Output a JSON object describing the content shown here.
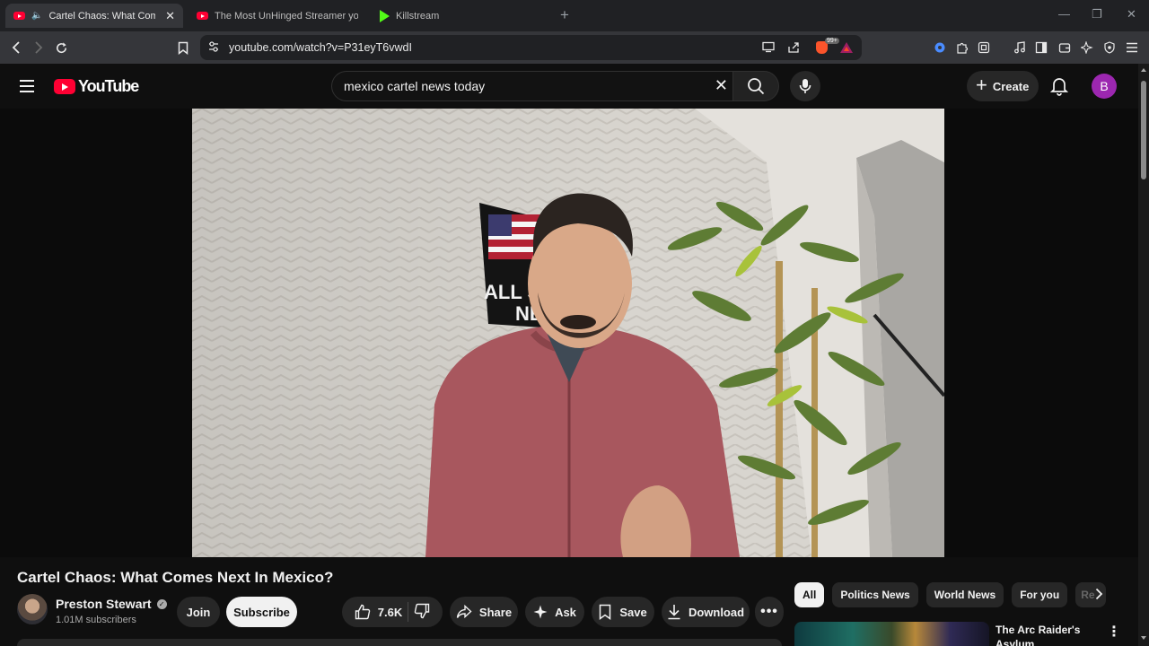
{
  "browser": {
    "tabs": [
      {
        "title": "Cartel Chaos: What Comes Ne",
        "active": true,
        "icon": "youtube-favicon"
      },
      {
        "title": "The Most UnHinged Streamer you've",
        "active": false,
        "icon": "youtube-favicon"
      },
      {
        "title": "Killstream",
        "active": false,
        "icon": "kick-favicon"
      }
    ],
    "url": "youtube.com/watch?v=P31eyT6vwdI",
    "brave_badge": "99+"
  },
  "youtube": {
    "logo_text": "YouTube",
    "search_query": "mexico cartel news today",
    "create_label": "Create",
    "avatar_letter": "B"
  },
  "video": {
    "title": "Cartel Chaos: What Comes Next In Mexico?",
    "channel_name": "Preston Stewart",
    "subscribers": "1.01M subscribers",
    "join_label": "Join",
    "subscribe_label": "Subscribe",
    "likes": "7.6K",
    "share_label": "Share",
    "ask_label": "Ask",
    "save_label": "Save",
    "download_label": "Download",
    "overlay_sign_line1": "ALL S",
    "overlay_sign_line2": "NE"
  },
  "sidebar": {
    "chips": [
      "All",
      "Politics News",
      "World News",
      "For you",
      "Re"
    ],
    "active_chip": "All",
    "recommendation_title": "The Arc Raider's Asylum"
  },
  "colors": {
    "yt_red": "#ff0033",
    "background": "#0f0f0f",
    "avatar": "#9c27b0"
  }
}
